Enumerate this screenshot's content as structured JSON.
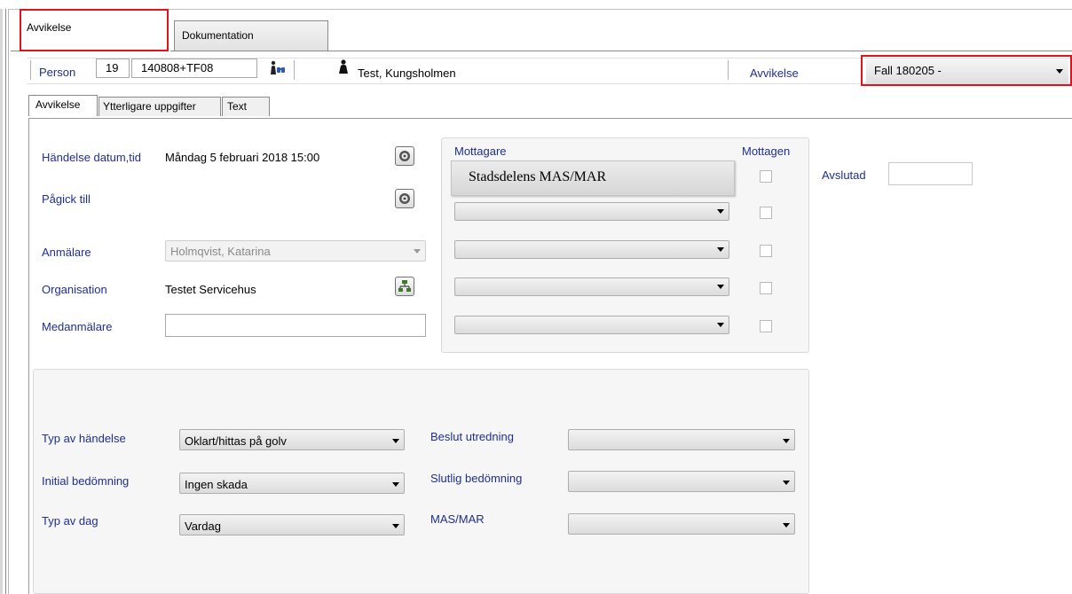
{
  "tabs": [
    {
      "label": "Avvikelse",
      "active": true,
      "highlighted": true
    },
    {
      "label": "Dokumentation",
      "active": false
    }
  ],
  "person_bar": {
    "person_label": "Person",
    "century": "19",
    "personnummer": "140808+TF08",
    "person_name": "Test, Kungsholmen",
    "avvikelse_label": "Avvikelse",
    "avvikelse_selected": "Fall 180205 -"
  },
  "subtabs": [
    {
      "label": "Avvikelse",
      "active": true
    },
    {
      "label": "Ytterligare uppgifter",
      "active": false
    },
    {
      "label": "Text",
      "active": false
    }
  ],
  "event": {
    "handelse_label": "Händelse datum,tid",
    "handelse_value": "Måndag 5 februari 2018 15:00",
    "pagick_label": "Pågick till",
    "anmalare_label": "Anmälare",
    "anmalare_value": "Holmqvist, Katarina",
    "organisation_label": "Organisation",
    "organisation_value": "Testet Servicehus",
    "medanmalare_label": "Medanmälare",
    "medanmalare_value": ""
  },
  "recipients": {
    "mottagare_header": "Mottagare",
    "mottagen_header": "Mottagen",
    "first_recipient": "Stadsdelens MAS/MAR",
    "rows": [
      "",
      "",
      "",
      ""
    ]
  },
  "avslutad": {
    "label": "Avslutad",
    "value": ""
  },
  "classification": {
    "typ_handelse_label": "Typ av händelse",
    "typ_handelse_value": "Oklart/hittas på golv",
    "initial_label": "Initial bedömning",
    "initial_value": "Ingen skada",
    "typ_dag_label": "Typ av dag",
    "typ_dag_value": "Vardag",
    "beslut_label": "Beslut utredning",
    "beslut_value": "",
    "slutlig_label": "Slutlig bedömning",
    "slutlig_value": "",
    "masmar_label": "MAS/MAR",
    "masmar_value": ""
  },
  "colors": {
    "highlight": "#e0141e",
    "label_blue": "#1f2f8f"
  }
}
